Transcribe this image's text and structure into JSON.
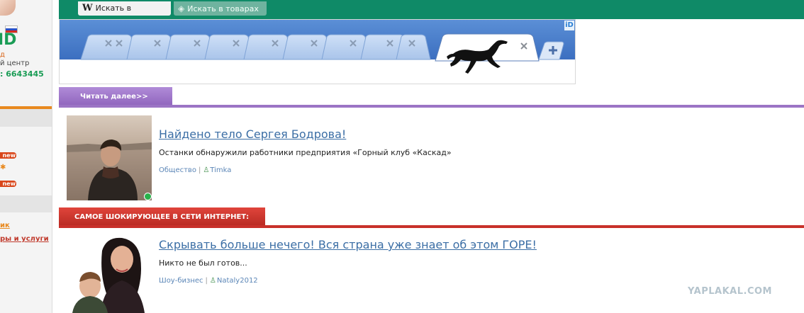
{
  "sidebar": {
    "logo_text": "ID",
    "line1": "д",
    "line2": "й центр",
    "phone": ": 6643445",
    "badges": [
      "new",
      "new"
    ],
    "links": [
      "ик",
      "ры и услуги"
    ]
  },
  "search_tabs": [
    {
      "icon": "W",
      "label": "Искать в интернете"
    },
    {
      "icon": "eye-icon",
      "label": "Искать в товарах"
    }
  ],
  "ad": {
    "marker": "iD"
  },
  "section1": {
    "label": "Читать далее>>",
    "color": "#9b74c5"
  },
  "article1": {
    "title": "Найдено тело Сергея Бодрова!",
    "description": "Останки обнаружили работники предприятия «Горный клуб «Каскад»",
    "category": "Общество",
    "author": "Timka"
  },
  "section2": {
    "label": "САМОЕ ШОКИРУЮЩЕЕ В СЕТИ ИНТЕРНЕТ:",
    "color": "#c8302a"
  },
  "article2": {
    "title": "Скрывать больше нечего! Вся страна уже знает об этом ГОРЕ!",
    "description": "Никто не был готов...",
    "category": "Шоу-бизнес",
    "author": "Nataly2012"
  },
  "watermark": "YAPLAKAL.COM",
  "colors": {
    "topbar": "#0f8a67",
    "link": "#3b6ea5",
    "sidebar_accent": "#e8891f"
  }
}
